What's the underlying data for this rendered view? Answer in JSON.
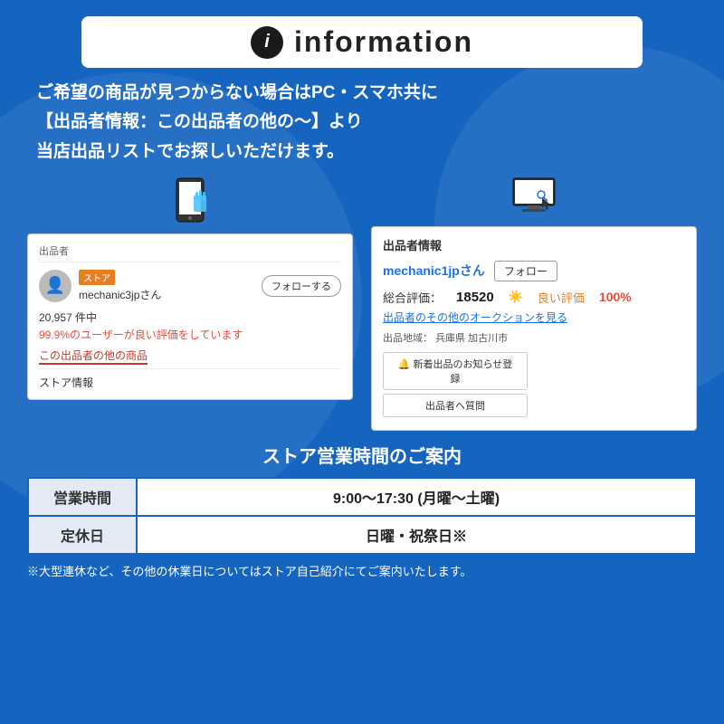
{
  "header": {
    "info_icon": "i",
    "title": "information"
  },
  "main_text": {
    "line1": "ご希望の商品が見つからない場合はPC・スマホ共に",
    "line2": "【出品者情報：この出品者の他の〜】より",
    "line3": "当店出品リストでお探しいただけます。"
  },
  "mobile_screenshot": {
    "seller_section_label": "出品者",
    "store_badge": "ストア",
    "seller_name": "mechanic3jpさん",
    "follow_button": "フォローする",
    "rating_count": "20,957 件中",
    "rating_pct": "99.9%のユーザーが良い評価をしています",
    "other_items_link": "この出品者の他の商品",
    "store_info_label": "ストア情報"
  },
  "desktop_screenshot": {
    "seller_info_label": "出品者情報",
    "seller_name": "mechanic1jpさん",
    "follow_button": "フォロー",
    "total_rating_label": "総合評価：",
    "total_rating_value": "18520",
    "good_rating_label": "良い評価",
    "good_rating_pct": "100%",
    "auction_link": "出品者のその他のオークションを見る",
    "location_label": "出品地域：",
    "location_value": "兵庫県 加古川市",
    "new_item_btn": "🔔 新着出品のお知らせ登録",
    "question_btn": "出品者へ質問"
  },
  "store_hours": {
    "section_title": "ストア営業時間のご案内",
    "rows": [
      {
        "label": "営業時間",
        "value": "9:00〜17:30 (月曜〜土曜)"
      },
      {
        "label": "定休日",
        "value": "日曜・祝祭日※"
      }
    ],
    "note": "※大型連休など、その他の休業日についてはストア自己紹介にてご案内いたします。"
  },
  "colors": {
    "background": "#1565c0",
    "header_bg": "#ffffff",
    "accent_red": "#c0392b",
    "accent_blue": "#1a73e8",
    "accent_orange": "#e67e22"
  }
}
